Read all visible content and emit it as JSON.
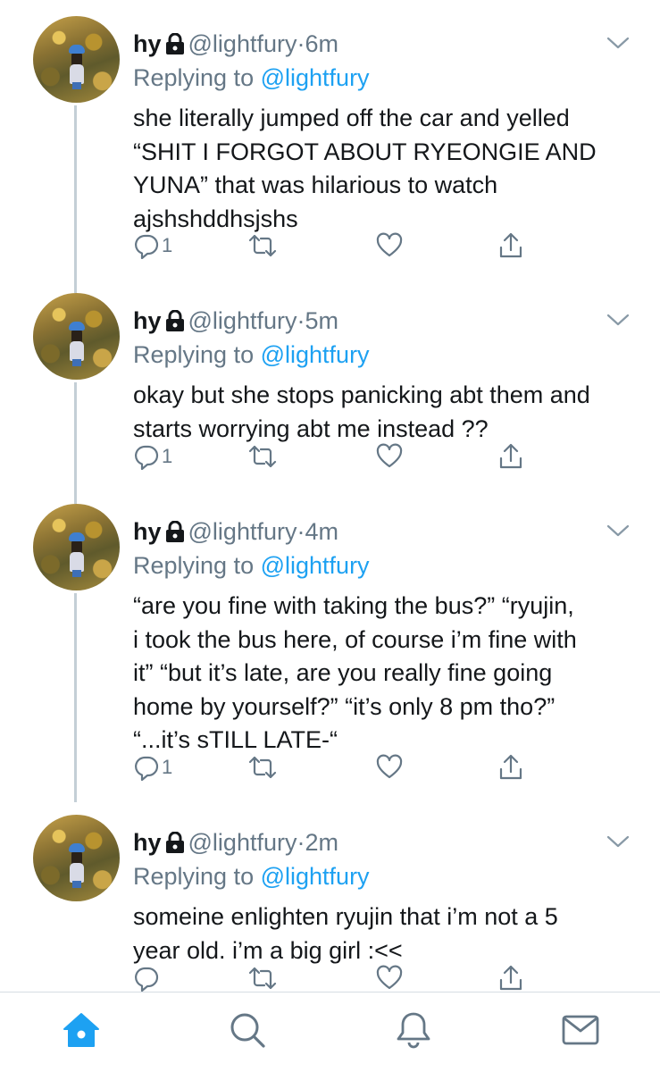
{
  "colors": {
    "accent": "#1da1f2",
    "text": "#14171a",
    "muted": "#657786",
    "thread_line": "#c4cfd6"
  },
  "tweets": [
    {
      "name": "hy",
      "handle": "@lightfury",
      "separator": "·",
      "time": "6m",
      "reply_prefix": "Replying to",
      "reply_to": "@lightfury",
      "text": "she literally jumped off the car and yelled\n“SHIT I FORGOT ABOUT RYEONGIE AND\nYUNA” that was hilarious to watch\najshshddhsjshs",
      "reply_count": "1"
    },
    {
      "name": "hy",
      "handle": "@lightfury",
      "separator": "·",
      "time": "5m",
      "reply_prefix": "Replying to",
      "reply_to": "@lightfury",
      "text": "okay but she stops panicking abt them and\nstarts worrying abt me instead ??",
      "reply_count": "1"
    },
    {
      "name": "hy",
      "handle": "@lightfury",
      "separator": "·",
      "time": "4m",
      "reply_prefix": "Replying to",
      "reply_to": "@lightfury",
      "text": "“are you fine with taking the bus?” “ryujin,\ni took the bus here, of course i’m fine with\nit” “but it’s late, are you really fine going\nhome by yourself?” “it’s only 8 pm tho?”\n“...it’s sTILL LATE-“",
      "reply_count": "1"
    },
    {
      "name": "hy",
      "handle": "@lightfury",
      "separator": "·",
      "time": "2m",
      "reply_prefix": "Replying to",
      "reply_to": "@lightfury",
      "text": "someine enlighten ryujin that i’m not a 5\nyear old. i’m a big girl :<<",
      "reply_count": ""
    }
  ],
  "icons": {
    "lock": "lock-icon",
    "menu": "chevron-down-icon",
    "reply": "reply-icon",
    "retweet": "retweet-icon",
    "like": "heart-icon",
    "share": "share-icon",
    "home": "home-icon",
    "search": "search-icon",
    "notifications": "bell-icon",
    "messages": "mail-icon"
  },
  "tabbar": {
    "active": "home"
  }
}
